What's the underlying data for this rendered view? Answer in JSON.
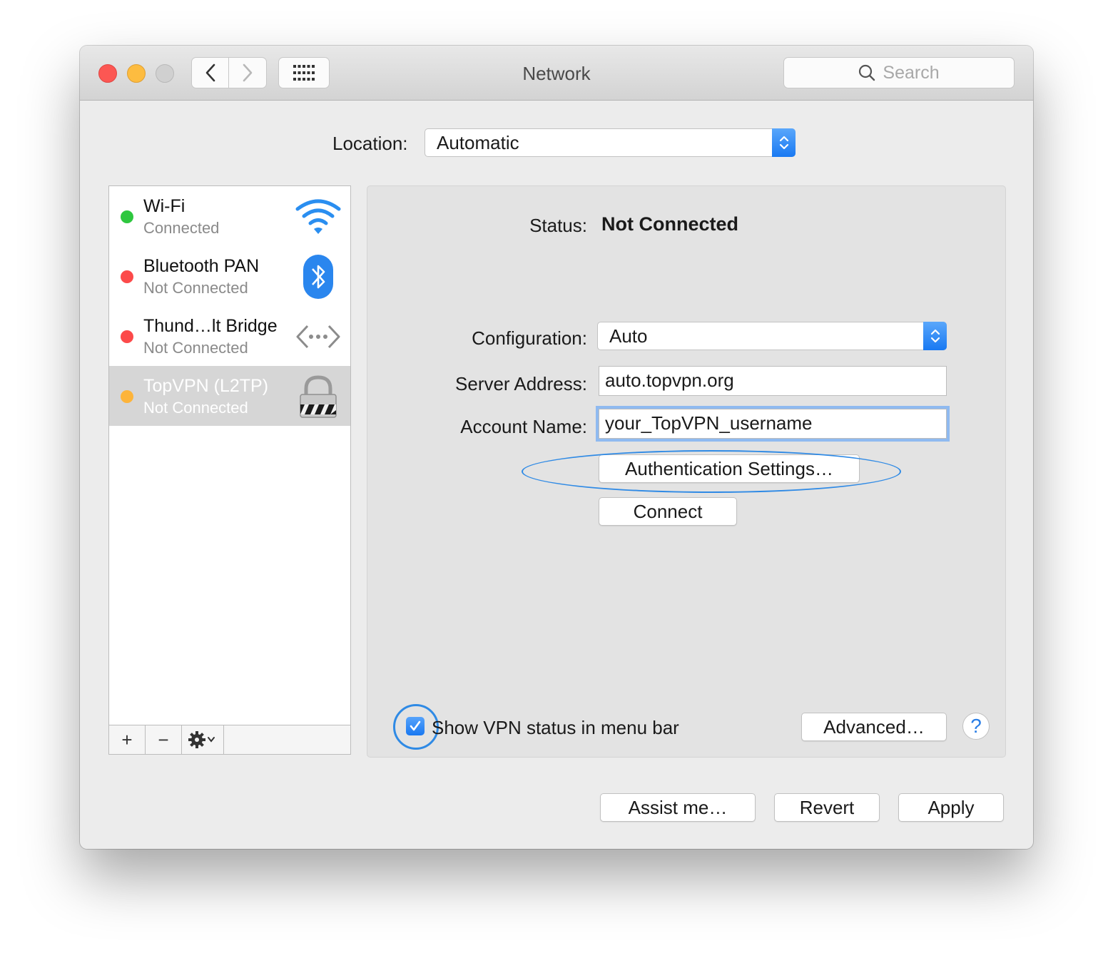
{
  "window": {
    "title": "Network",
    "search_placeholder": "Search"
  },
  "location": {
    "label": "Location:",
    "value": "Automatic"
  },
  "services": [
    {
      "name": "Wi-Fi",
      "status": "Connected",
      "dot_color": "#2ec73f",
      "icon": "wifi-icon"
    },
    {
      "name": "Bluetooth PAN",
      "status": "Not Connected",
      "dot_color": "#fc4a4a",
      "icon": "bluetooth-icon"
    },
    {
      "name": "Thund…lt Bridge",
      "status": "Not Connected",
      "dot_color": "#fc4a4a",
      "icon": "ethernet-bridge-icon"
    },
    {
      "name": "TopVPN (L2TP)",
      "status": "Not Connected",
      "dot_color": "#fdb43a",
      "icon": "vpn-lock-icon"
    }
  ],
  "sidebar_controls": {
    "add": "+",
    "remove": "−"
  },
  "detail": {
    "status_label": "Status:",
    "status_value": "Not Connected",
    "configuration_label": "Configuration:",
    "configuration_value": "Auto",
    "server_label": "Server Address:",
    "server_value": "auto.topvpn.org",
    "account_label": "Account Name:",
    "account_value": "your_TopVPN_username",
    "auth_button": "Authentication Settings…",
    "connect_button": "Connect",
    "show_vpn_label": "Show VPN status in menu bar",
    "show_vpn_checked": true,
    "advanced_button": "Advanced…",
    "help_button": "?"
  },
  "footer": {
    "assist_button": "Assist me…",
    "revert_button": "Revert",
    "apply_button": "Apply"
  },
  "colors": {
    "accent": "#1a7cf2",
    "highlight_annotation": "#2f8ae5",
    "selected_row": "#d6d6d6"
  }
}
